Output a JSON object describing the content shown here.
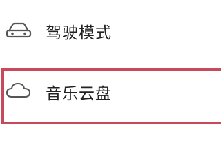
{
  "menu": {
    "items": [
      {
        "label": "驾驶模式",
        "icon": "car-icon"
      },
      {
        "label": "音乐云盘",
        "icon": "cloud-icon"
      }
    ]
  },
  "colors": {
    "highlight": "#c84a5a",
    "text": "#222222",
    "icon": "#555555"
  }
}
